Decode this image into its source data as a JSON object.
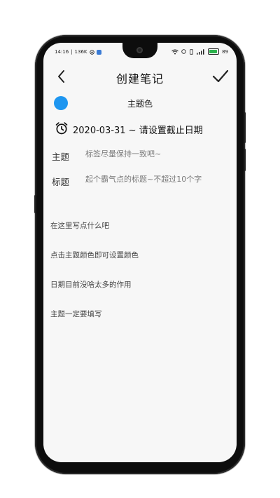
{
  "status_bar": {
    "time": "14:16",
    "speed": "136K",
    "battery": "89",
    "battery_level": 0.89
  },
  "toolbar": {
    "title": "创建笔记"
  },
  "theme_color": {
    "label": "主题色",
    "color": "#1e96f0"
  },
  "deadline": {
    "text": "2020-03-31 ~ 请设置截止日期"
  },
  "fields": {
    "topic_label": "主题",
    "topic_placeholder": "标签尽量保持一致吧~",
    "title_label": "标题",
    "title_placeholder": "起个霸气点的标题~不超过10个字"
  },
  "body": {
    "lines": [
      "在这里写点什么吧",
      "点击主题颜色即可设置颜色",
      "日期目前没啥太多的作用",
      "主题一定要填写"
    ]
  }
}
